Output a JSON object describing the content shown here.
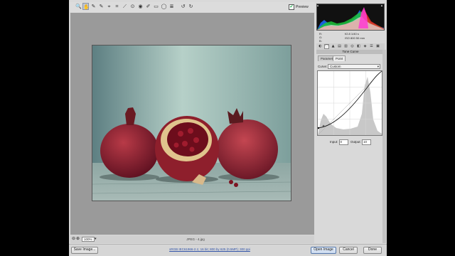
{
  "toolbar": {
    "tools": [
      {
        "name": "zoom-tool-icon",
        "glyph": "🔍"
      },
      {
        "name": "hand-tool-icon",
        "glyph": "✋"
      },
      {
        "name": "white-balance-tool-icon",
        "glyph": "✎"
      },
      {
        "name": "color-sampler-tool-icon",
        "glyph": "✎"
      },
      {
        "name": "targeted-adjustment-tool-icon",
        "glyph": "⌖"
      },
      {
        "name": "crop-tool-icon",
        "glyph": "⌗"
      },
      {
        "name": "straighten-tool-icon",
        "glyph": "⟋"
      },
      {
        "name": "spot-removal-tool-icon",
        "glyph": "⊙"
      },
      {
        "name": "red-eye-tool-icon",
        "glyph": "◉"
      },
      {
        "name": "adjustment-brush-icon",
        "glyph": "✐"
      },
      {
        "name": "graduated-filter-icon",
        "glyph": "▭"
      },
      {
        "name": "radial-filter-icon",
        "glyph": "◯"
      },
      {
        "name": "preferences-icon",
        "glyph": "≣"
      },
      {
        "name": "rotate-left-icon",
        "glyph": "↺"
      },
      {
        "name": "rotate-right-icon",
        "glyph": "↻"
      }
    ],
    "preview_label": "Preview",
    "preview_checked": true
  },
  "histogram": {
    "info_left": [
      "R:",
      "G:",
      "B:"
    ],
    "info_right_line1": "f/2.8   1/40 s",
    "info_right_line2": "ISO 800   50 mm"
  },
  "panel": {
    "title": "Tone Curve",
    "tabs": [
      "Parametric",
      "Point"
    ],
    "active_tab": "Point",
    "curve_label": "Curve:",
    "curve_value": "Custom",
    "input_label": "Input:",
    "input_value": "0",
    "output_label": "Output:",
    "output_value": "10"
  },
  "zoom": {
    "value": "100%"
  },
  "status": {
    "filename": "JPEG - 4.jpg",
    "workflow_link": "sRGB IEC61966-2.1; 16 bit; 800 by 625 (0.5MP); 300 ppi"
  },
  "buttons": {
    "save": "Save Image...",
    "open": "Open Image",
    "cancel": "Cancel",
    "done": "Done"
  },
  "colors": {
    "accent_blue": "#3355aa",
    "photo_background": "#8fb1ad",
    "pomegranate": "#8c1f2e"
  }
}
